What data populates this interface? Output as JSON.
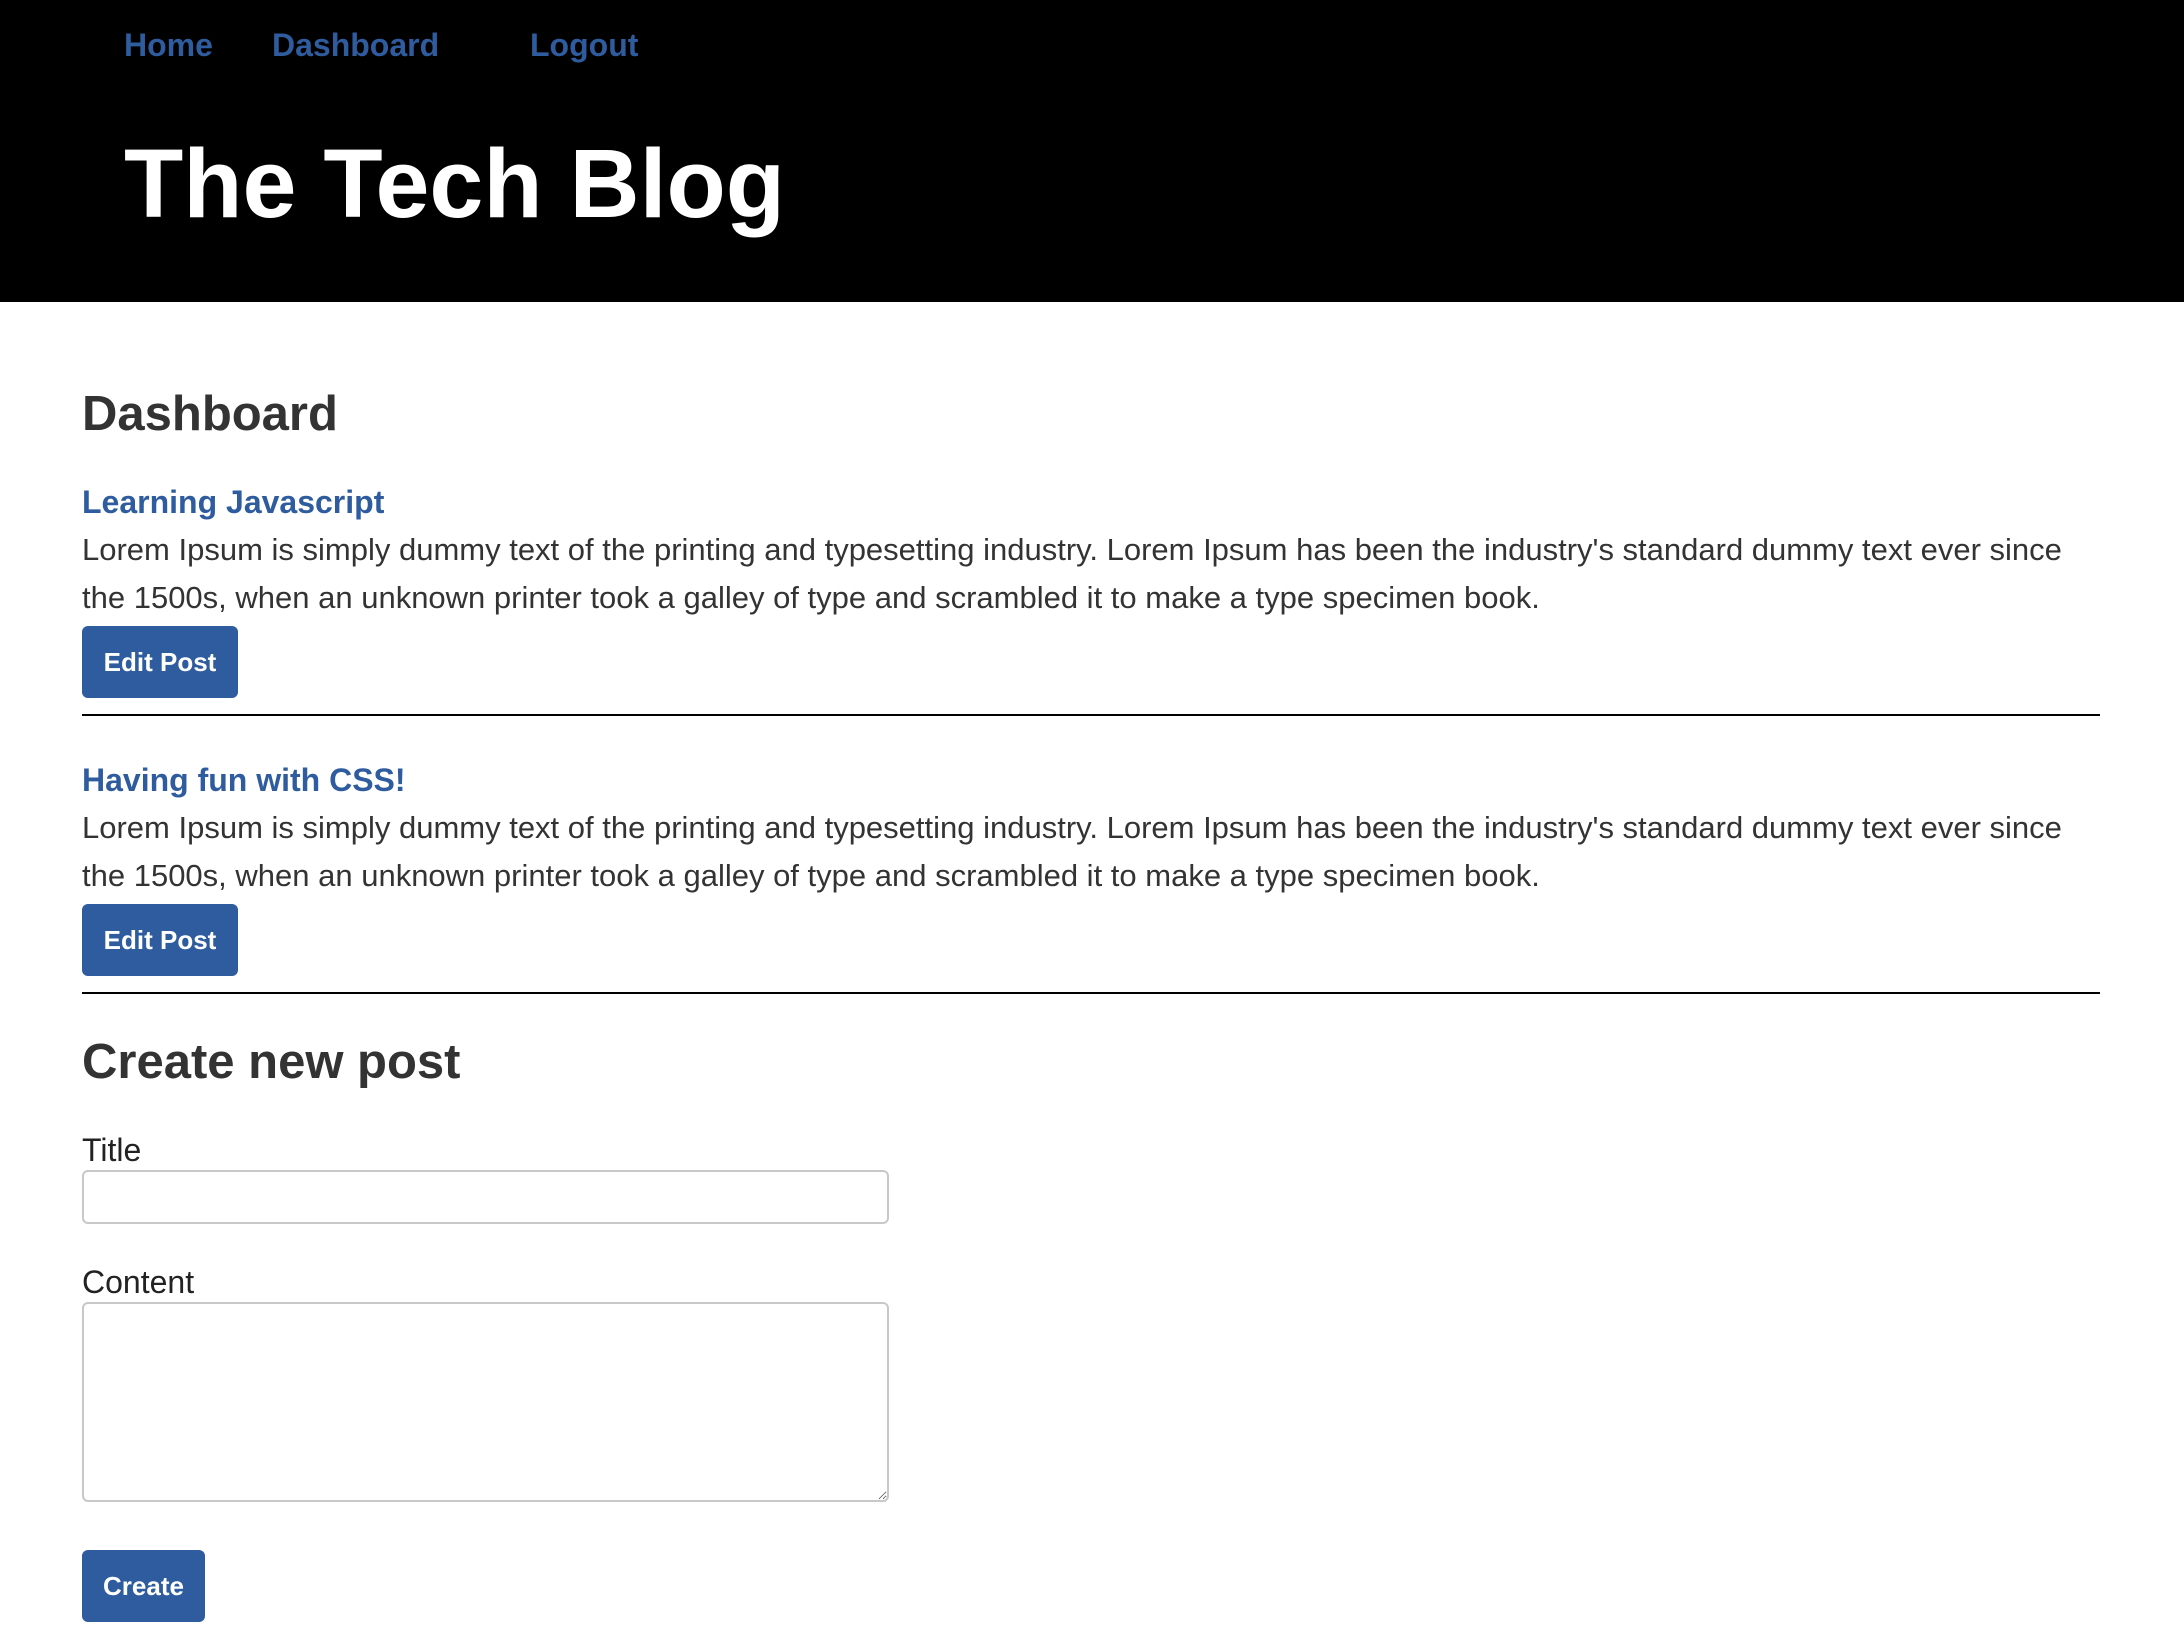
{
  "nav": {
    "home": "Home",
    "dashboard": "Dashboard",
    "logout": "Logout"
  },
  "site": {
    "title": "The Tech Blog"
  },
  "page": {
    "heading": "Dashboard"
  },
  "posts": [
    {
      "title": "Learning Javascript",
      "body": "Lorem Ipsum is simply dummy text of the printing and typesetting industry. Lorem Ipsum has been the industry's standard dummy text ever since the 1500s, when an unknown printer took a galley of type and scrambled it to make a type specimen book.",
      "edit_label": "Edit Post"
    },
    {
      "title": "Having fun with CSS!",
      "body": "Lorem Ipsum is simply dummy text of the printing and typesetting industry. Lorem Ipsum has been the industry's standard dummy text ever since the 1500s, when an unknown printer took a galley of type and scrambled it to make a type specimen book.",
      "edit_label": "Edit Post"
    }
  ],
  "form": {
    "heading": "Create new post",
    "title_label": "Title",
    "title_value": "",
    "content_label": "Content",
    "content_value": "",
    "submit_label": "Create"
  },
  "colors": {
    "header_bg": "#000000",
    "link": "#2e5c9e",
    "button_bg": "#2e5c9e",
    "text": "#333333"
  }
}
